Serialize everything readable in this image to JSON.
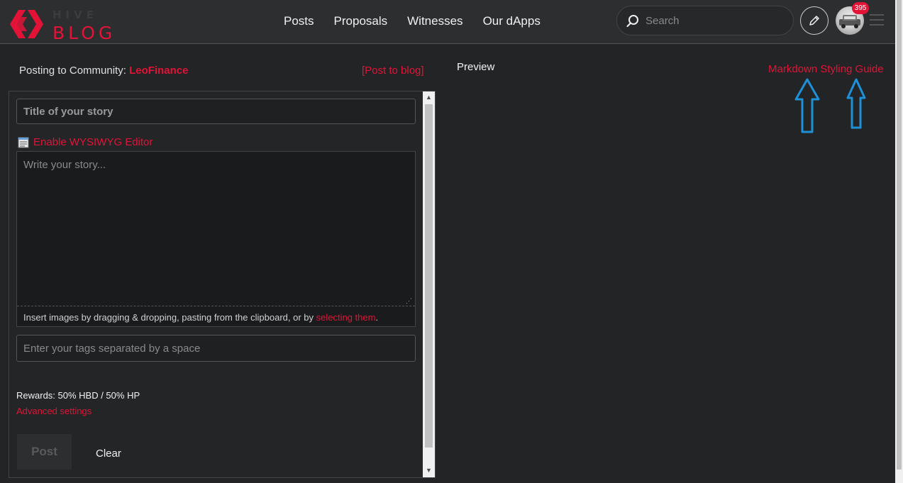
{
  "header": {
    "logo_text": "BLOG",
    "logo_hidden_text": "HIVE",
    "nav": [
      "Posts",
      "Proposals",
      "Witnesses",
      "Our dApps"
    ],
    "search_placeholder": "Search",
    "notification_count": "395",
    "icons": {
      "logo": "hive-logo-icon",
      "search": "search-icon",
      "edit": "pencil-icon",
      "menu": "hamburger-menu-icon"
    }
  },
  "composer": {
    "posting_prefix": "Posting to Community: ",
    "community": "LeoFinance",
    "post_to_blog": "[Post to blog]",
    "title_placeholder": "Title of your story",
    "wysiwyg_label": "Enable WYSIWYG Editor",
    "story_placeholder": "Write your story...",
    "insert_hint": "Insert images by dragging & dropping, pasting from the clipboard, or by ",
    "insert_link": "selecting them",
    "insert_suffix": ".",
    "tags_placeholder": "Enter your tags separated by a space",
    "rewards": "Rewards: 50% HBD / 50% HP",
    "advanced_settings": "Advanced settings",
    "post_button": "Post",
    "clear_button": "Clear"
  },
  "preview": {
    "label": "Preview",
    "markdown_guide": "Markdown Styling Guide"
  },
  "colors": {
    "accent": "#e31337",
    "arrow": "#1e90d8",
    "background": "#222426",
    "header": "#2c2e30"
  }
}
